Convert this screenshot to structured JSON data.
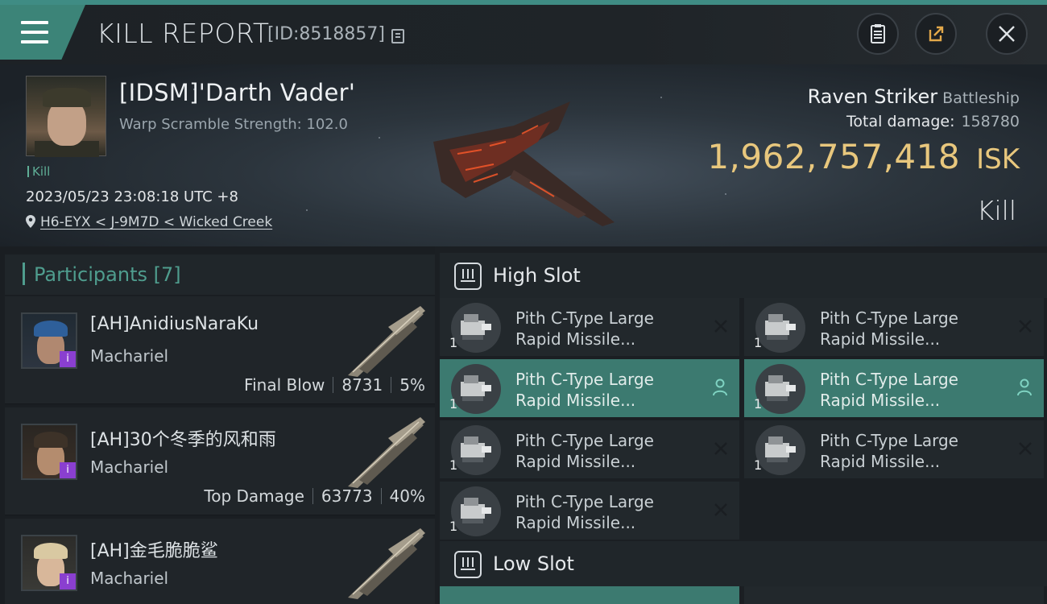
{
  "topbar": {
    "title": "KILL REPORT",
    "report_id": "[ID:8518857]"
  },
  "victim": {
    "name": "[IDSM]'Darth Vader'",
    "warp_scramble": "Warp Scramble Strength: 102.0",
    "tag": "Kill",
    "datetime": "2023/05/23 23:08:18 UTC +8",
    "location": "H6-EYX < J-9M7D < Wicked Creek",
    "ship_name": "Raven Striker",
    "ship_class": "Battleship",
    "total_damage_label": "Total damage:",
    "total_damage_value": "158780",
    "isk_value": "1,962,757,418",
    "isk_unit": "ISK",
    "result": "Kill"
  },
  "participants": {
    "label": "Participants [7]",
    "items": [
      {
        "name": "[AH]AnidiusNaraKu",
        "ship": "Machariel",
        "stat_label": "Final Blow",
        "damage": "8731",
        "percent": "5%"
      },
      {
        "name": "[AH]30个冬季的风和雨",
        "ship": "Machariel",
        "stat_label": "Top Damage",
        "damage": "63773",
        "percent": "40%"
      },
      {
        "name": "[AH]金毛脆脆鲨",
        "ship": "Machariel",
        "stat_label": "",
        "damage": "",
        "percent": ""
      }
    ]
  },
  "slots": {
    "high_label": "High Slot",
    "low_label": "Low Slot",
    "module_line1": "Pith C-Type Large",
    "module_line2": "Rapid Missile...",
    "qty": "1",
    "badge": "i"
  },
  "colors": {
    "accent": "#3c8478",
    "isk": "#e8c77d",
    "active_module": "#3c7a70",
    "participants_label": "#4f9d8e"
  }
}
